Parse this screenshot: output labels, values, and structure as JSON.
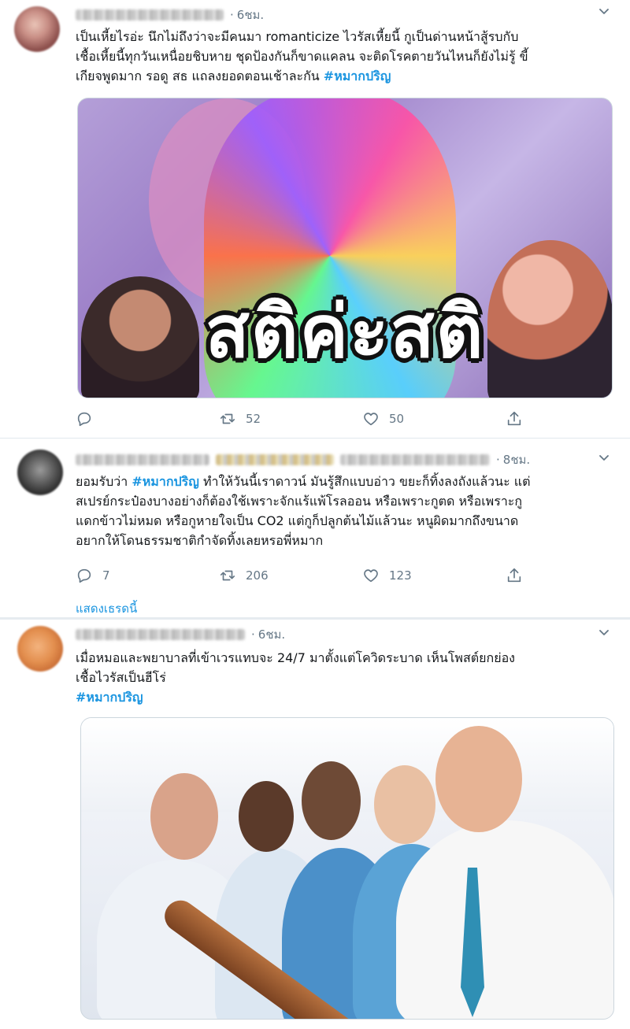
{
  "tweets": [
    {
      "time": "6ชม.",
      "lines": [
        "เป็นเหี้ยไรอ่ะ นึกไม่ถึงว่าจะมีคนมา romanticize ไวรัสเหี้ยนี้ กูเป็นด่านหน้าสู้รบกับ",
        "เชื้อเหี้ยนี้ทุกวันเหนื่อยชิบหาย ชุดป้องกันก็ขาดแคลน จะติดโรคตายวันไหนก็ยังไม่รู้ ขี้",
        "เกียจพูดมาก รอดู สธ แถลงยอดตอนเช้าละกัน "
      ],
      "hashtag": "#หมากปริญ",
      "image_caption": "สติค่ะสติ",
      "reply_count": "",
      "retweet_count": "52",
      "like_count": "50"
    },
    {
      "time": "8ชม.",
      "lines": [
        "ยอมรับว่า ",
        " ทำให้วันนี้เราดาวน์ มันรู้สึกแบบอ่าว ขยะก็ทิ้งลงถังแล้วนะ แต่",
        "สเปรย์กระป๋องบางอย่างก็ต้องใช้เพราะจักแร้แพ้โรลออน หรือเพราะกูตด หรือเพราะกู",
        "แดกข้าวไม่หมด หรือกูหายใจเป็น CO2 แต่กูก็ปลูกต้นไม้แล้วนะ หนูผิดมากถึงขนาด",
        "อยากให้โดนธรรมชาติกำจัดทิ้งเลยหรอพี่หมาก"
      ],
      "hashtag": "#หมากปริญ",
      "reply_count": "7",
      "retweet_count": "206",
      "like_count": "123",
      "show_thread": "แสดงเธรดนี้"
    },
    {
      "time": "6ชม.",
      "lines": [
        "เมื่อหมอและพยาบาลที่เข้าเวรแทบจะ 24/7 มาตั้งแต่โควิดระบาด เห็นโพสต์ยกย่อง",
        "เชื้อไวรัสเป็นฮีโร่"
      ],
      "hashtag": "#หมากปริญ"
    }
  ],
  "colors": {
    "link": "#1b95e0",
    "meta": "#657786",
    "text": "#14171a"
  }
}
